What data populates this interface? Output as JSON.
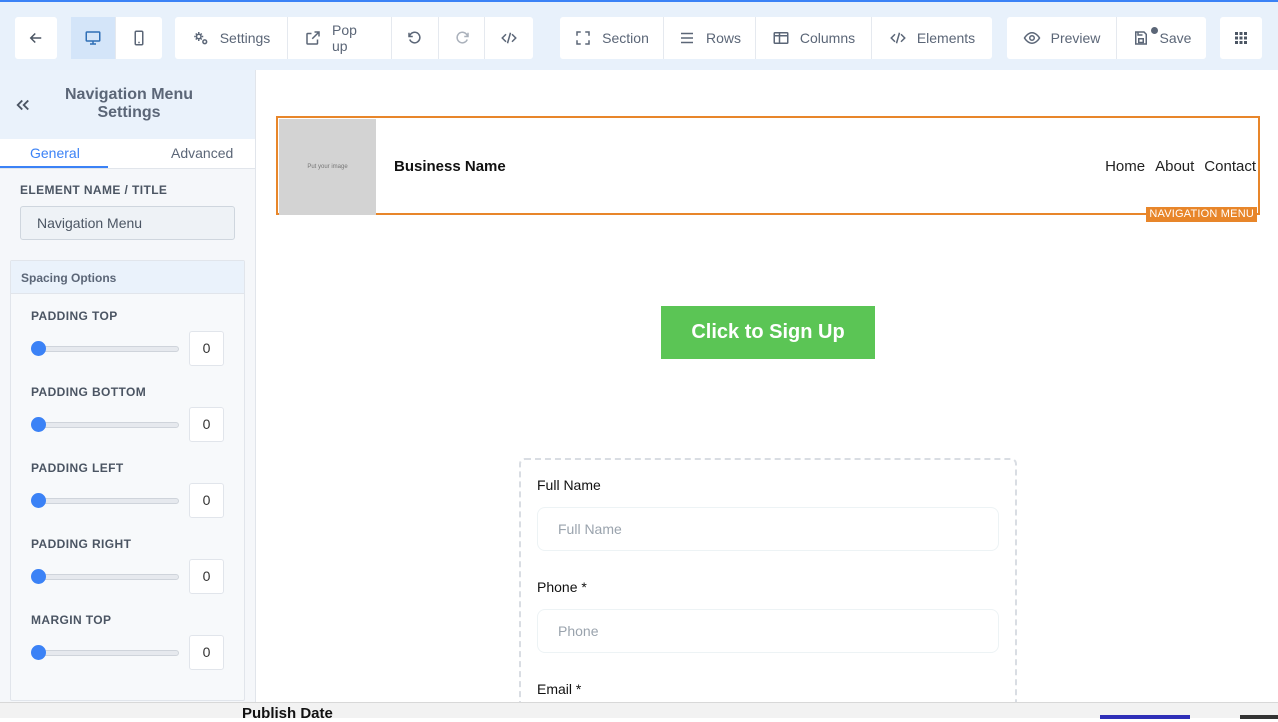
{
  "toolbar": {
    "settings_label": "Settings",
    "popup_label": "Pop up",
    "section_label": "Section",
    "rows_label": "Rows",
    "columns_label": "Columns",
    "elements_label": "Elements",
    "preview_label": "Preview",
    "save_label": "Save"
  },
  "sidebar": {
    "title": "Navigation Menu Settings",
    "tabs": [
      {
        "label": "General",
        "active": true
      },
      {
        "label": "Advanced",
        "active": false
      }
    ],
    "element_name_label": "ELEMENT NAME / TITLE",
    "element_name_value": "Navigation Menu",
    "spacing_title": "Spacing Options",
    "spacing": [
      {
        "label": "PADDING TOP",
        "value": "0"
      },
      {
        "label": "PADDING BOTTOM",
        "value": "0"
      },
      {
        "label": "PADDING LEFT",
        "value": "0"
      },
      {
        "label": "PADDING RIGHT",
        "value": "0"
      },
      {
        "label": "MARGIN TOP",
        "value": "0"
      }
    ]
  },
  "canvas": {
    "logo_placeholder": "Put your image",
    "business_name": "Business Name",
    "nav_links": [
      "Home",
      "About",
      "Contact"
    ],
    "nav_tag": "NAVIGATION MENU",
    "signup_button": "Click to Sign Up",
    "form": {
      "full_name_label": "Full Name",
      "full_name_placeholder": "Full Name",
      "phone_label": "Phone *",
      "phone_placeholder": "Phone",
      "email_label": "Email *"
    }
  },
  "bottom_text": "Publish Date",
  "colors": {
    "accent": "#3b82f6",
    "highlight": "#e8862a",
    "signup": "#5bc555"
  }
}
